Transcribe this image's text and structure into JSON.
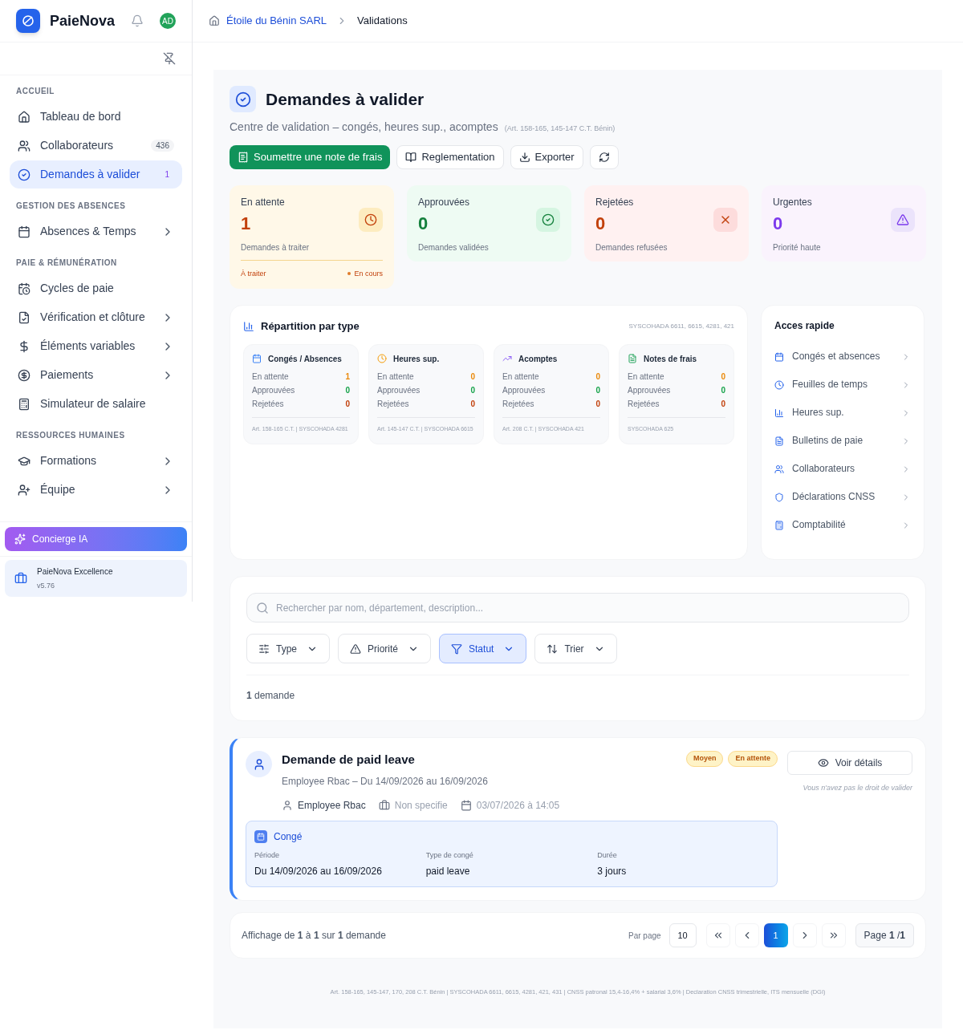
{
  "brand": {
    "name": "PaieNova",
    "avatar": "AD"
  },
  "breadcrumb": [
    "Étoile du Bénin SARL",
    "Validations"
  ],
  "sidebar": {
    "sections": [
      {
        "heading": "ACCUEIL",
        "items": [
          {
            "label": "Tableau de bord",
            "selected": false
          },
          {
            "label": "Collaborateurs",
            "badge": "436",
            "selected": false
          },
          {
            "label": "Demandes à valider",
            "badge": "1",
            "selected": true
          }
        ]
      },
      {
        "heading": "GESTION DES ABSENCES",
        "items": [
          {
            "label": "Absences & Temps",
            "expandable": true,
            "selected": false
          }
        ]
      },
      {
        "heading": "PAIE & RÉMUNÉRATION",
        "items": [
          {
            "label": "Cycles de paie",
            "selected": false
          },
          {
            "label": "Vérification et clôture",
            "expandable": true,
            "selected": false
          },
          {
            "label": "Éléments variables",
            "expandable": true,
            "selected": false
          },
          {
            "label": "Paiements",
            "expandable": true,
            "selected": false
          },
          {
            "label": "Simulateur de salaire",
            "selected": false
          }
        ]
      },
      {
        "heading": "RESSOURCES HUMAINES",
        "items": [
          {
            "label": "Formations",
            "expandable": true,
            "selected": false
          },
          {
            "label": "Équipe",
            "expandable": true,
            "selected": false
          }
        ]
      }
    ],
    "concierge": "Concierge IA",
    "plan": {
      "name": "PaieNova Excellence",
      "version": "v5.76"
    }
  },
  "header": {
    "title": "Demandes à valider",
    "subtitle": "Centre de validation – congés, heures sup., acomptes",
    "note": "(Art. 158-165, 145-147 C.T. Bénin)"
  },
  "actions": [
    {
      "label": "Soumettre une note de frais",
      "kind": "primary"
    },
    {
      "label": "Reglementation",
      "kind": "book"
    },
    {
      "label": "Exporter",
      "kind": "export"
    },
    {
      "kind": "refresh"
    }
  ],
  "stats": [
    {
      "label": "En attente",
      "value": "1",
      "caption": "Demandes à traiter",
      "color": "#c2410c",
      "footer": {
        "left": "À traiter",
        "right": "En cours"
      }
    },
    {
      "label": "Approuvées",
      "value": "0",
      "caption": "Demandes validées",
      "color": "#15803d"
    },
    {
      "label": "Rejetées",
      "value": "0",
      "caption": "Demandes refusées",
      "color": "#c2410c"
    },
    {
      "label": "Urgentes",
      "value": "0",
      "caption": "Priorité haute",
      "color": "#7c3aed"
    }
  ],
  "breakdown": {
    "title": "Répartition par type",
    "codes": "SYSCOHADA 6611, 6615, 4281, 421",
    "cards": [
      {
        "title": "Congés / Absences",
        "rows": [
          {
            "label": "En attente",
            "value": "1"
          },
          {
            "label": "Approuvées",
            "value": "0"
          },
          {
            "label": "Rejetées",
            "value": "0"
          }
        ],
        "note": "Art. 158-165 C.T. | SYSCOHADA 4281"
      },
      {
        "title": "Heures sup.",
        "rows": [
          {
            "label": "En attente",
            "value": "0"
          },
          {
            "label": "Approuvées",
            "value": "0"
          },
          {
            "label": "Rejetées",
            "value": "0"
          }
        ],
        "note": "Art. 145-147 C.T. | SYSCOHADA 6615"
      },
      {
        "title": "Acomptes",
        "rows": [
          {
            "label": "En attente",
            "value": "0"
          },
          {
            "label": "Approuvées",
            "value": "0"
          },
          {
            "label": "Rejetées",
            "value": "0"
          }
        ],
        "note": "Art. 208 C.T. | SYSCOHADA 421"
      },
      {
        "title": "Notes de frais",
        "rows": [
          {
            "label": "En attente",
            "value": "0"
          },
          {
            "label": "Approuvées",
            "value": "0"
          },
          {
            "label": "Rejetées",
            "value": "0"
          }
        ],
        "note": "SYSCOHADA 625"
      }
    ]
  },
  "quick_access": {
    "title": "Acces rapide",
    "items": [
      "Congés et absences",
      "Feuilles de temps",
      "Heures sup.",
      "Bulletins de paie",
      "Collaborateurs",
      "Déclarations CNSS",
      "Comptabilité"
    ]
  },
  "filters": {
    "search_placeholder": "Rechercher par nom, département, description...",
    "buttons": [
      {
        "label": "Type",
        "selected": false
      },
      {
        "label": "Priorité",
        "selected": false
      },
      {
        "label": "Statut",
        "selected": true
      },
      {
        "label": "Trier",
        "selected": false
      }
    ],
    "count": "**1** demande"
  },
  "request": {
    "title": "Demande de paid leave",
    "subtitle": "Employee Rbac – Du 14/09/2026 au 16/09/2026",
    "person": "Employee Rbac",
    "department": "Non specifie",
    "date": "03/07/2026 à 14:05",
    "badges": [
      "Moyen",
      "En attente"
    ],
    "detail": {
      "label": "Congé",
      "fields": [
        {
          "label": "Période",
          "value": "Du 14/09/2026 au 16/09/2026"
        },
        {
          "label": "Type de congé",
          "value": "paid leave"
        },
        {
          "label": "Durée",
          "value": "3 jours"
        }
      ]
    },
    "action": "Voir détails",
    "notice": "Vous n'avez pas le droit de valider"
  },
  "pagination": {
    "summary": "Affichage de **1** à **1** sur **1** demande",
    "per_page_label": "Par page",
    "per_page": "10",
    "pages": [
      {
        "label": "1",
        "selected": true
      }
    ],
    "page_info": "Page **1** /**1**"
  },
  "footer": "Art. 158-165, 145-147, 170, 208 C.T. Bénin | SYSCOHADA 6611, 6615, 4281, 421, 431 | CNSS patronal 15,4-16,4% + salarial 3,6% | Declaration CNSS trimestrielle, ITS mensuelle (DGI)"
}
